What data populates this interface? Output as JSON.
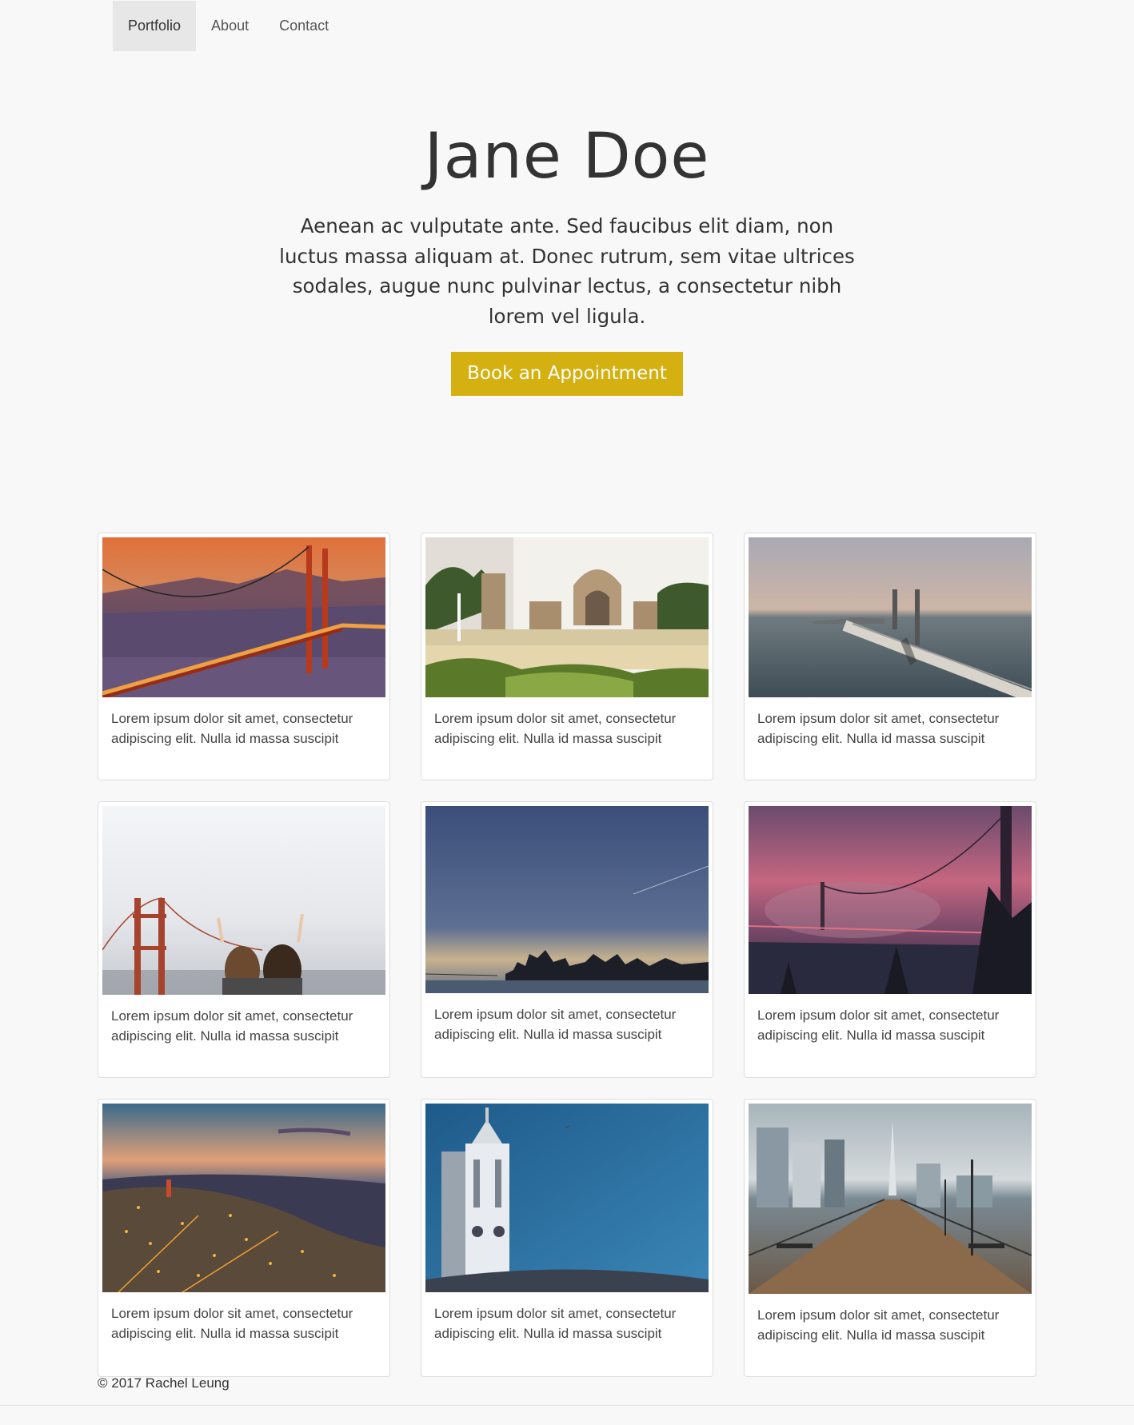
{
  "nav": {
    "items": [
      {
        "label": "Portfolio",
        "active": true
      },
      {
        "label": "About",
        "active": false
      },
      {
        "label": "Contact",
        "active": false
      }
    ]
  },
  "hero": {
    "title": "Jane Doe",
    "text": "Aenean ac vulputate ante. Sed faucibus elit diam, non luctus massa aliquam at. Donec rutrum, sem vitae ultrices sodales, augue nunc pulvinar lectus, a consectetur nibh lorem vel ligula.",
    "button_label": "Book an Appointment",
    "button_color": "#d4b010"
  },
  "gallery": {
    "cards": [
      {
        "caption": "Lorem ipsum dolor sit amet, consectetur adipiscing elit. Nulla id massa suscipit",
        "image": "golden-gate-sunset-photo"
      },
      {
        "caption": "Lorem ipsum dolor sit amet, consectetur adipiscing elit. Nulla id massa suscipit",
        "image": "palace-of-fine-arts-photo"
      },
      {
        "caption": "Lorem ipsum dolor sit amet, consectetur adipiscing elit. Nulla id massa suscipit",
        "image": "bay-bridge-aerial-photo"
      },
      {
        "caption": "Lorem ipsum dolor sit amet, consectetur adipiscing elit. Nulla id massa suscipit",
        "image": "golden-gate-fog-friends-photo"
      },
      {
        "caption": "Lorem ipsum dolor sit amet, consectetur adipiscing elit. Nulla id massa suscipit",
        "image": "city-skyline-dusk-photo"
      },
      {
        "caption": "Lorem ipsum dolor sit amet, consectetur adipiscing elit. Nulla id massa suscipit",
        "image": "bay-bridge-pink-fog-photo"
      },
      {
        "caption": "Lorem ipsum dolor sit amet, consectetur adipiscing elit. Nulla id massa suscipit",
        "image": "city-lights-aerial-photo"
      },
      {
        "caption": "Lorem ipsum dolor sit amet, consectetur adipiscing elit. Nulla id massa suscipit",
        "image": "ferry-building-tower-photo"
      },
      {
        "caption": "Lorem ipsum dolor sit amet, consectetur adipiscing elit. Nulla id massa suscipit",
        "image": "pier-seven-boardwalk-photo"
      }
    ]
  },
  "footer": {
    "text": "© 2017 Rachel Leung"
  }
}
